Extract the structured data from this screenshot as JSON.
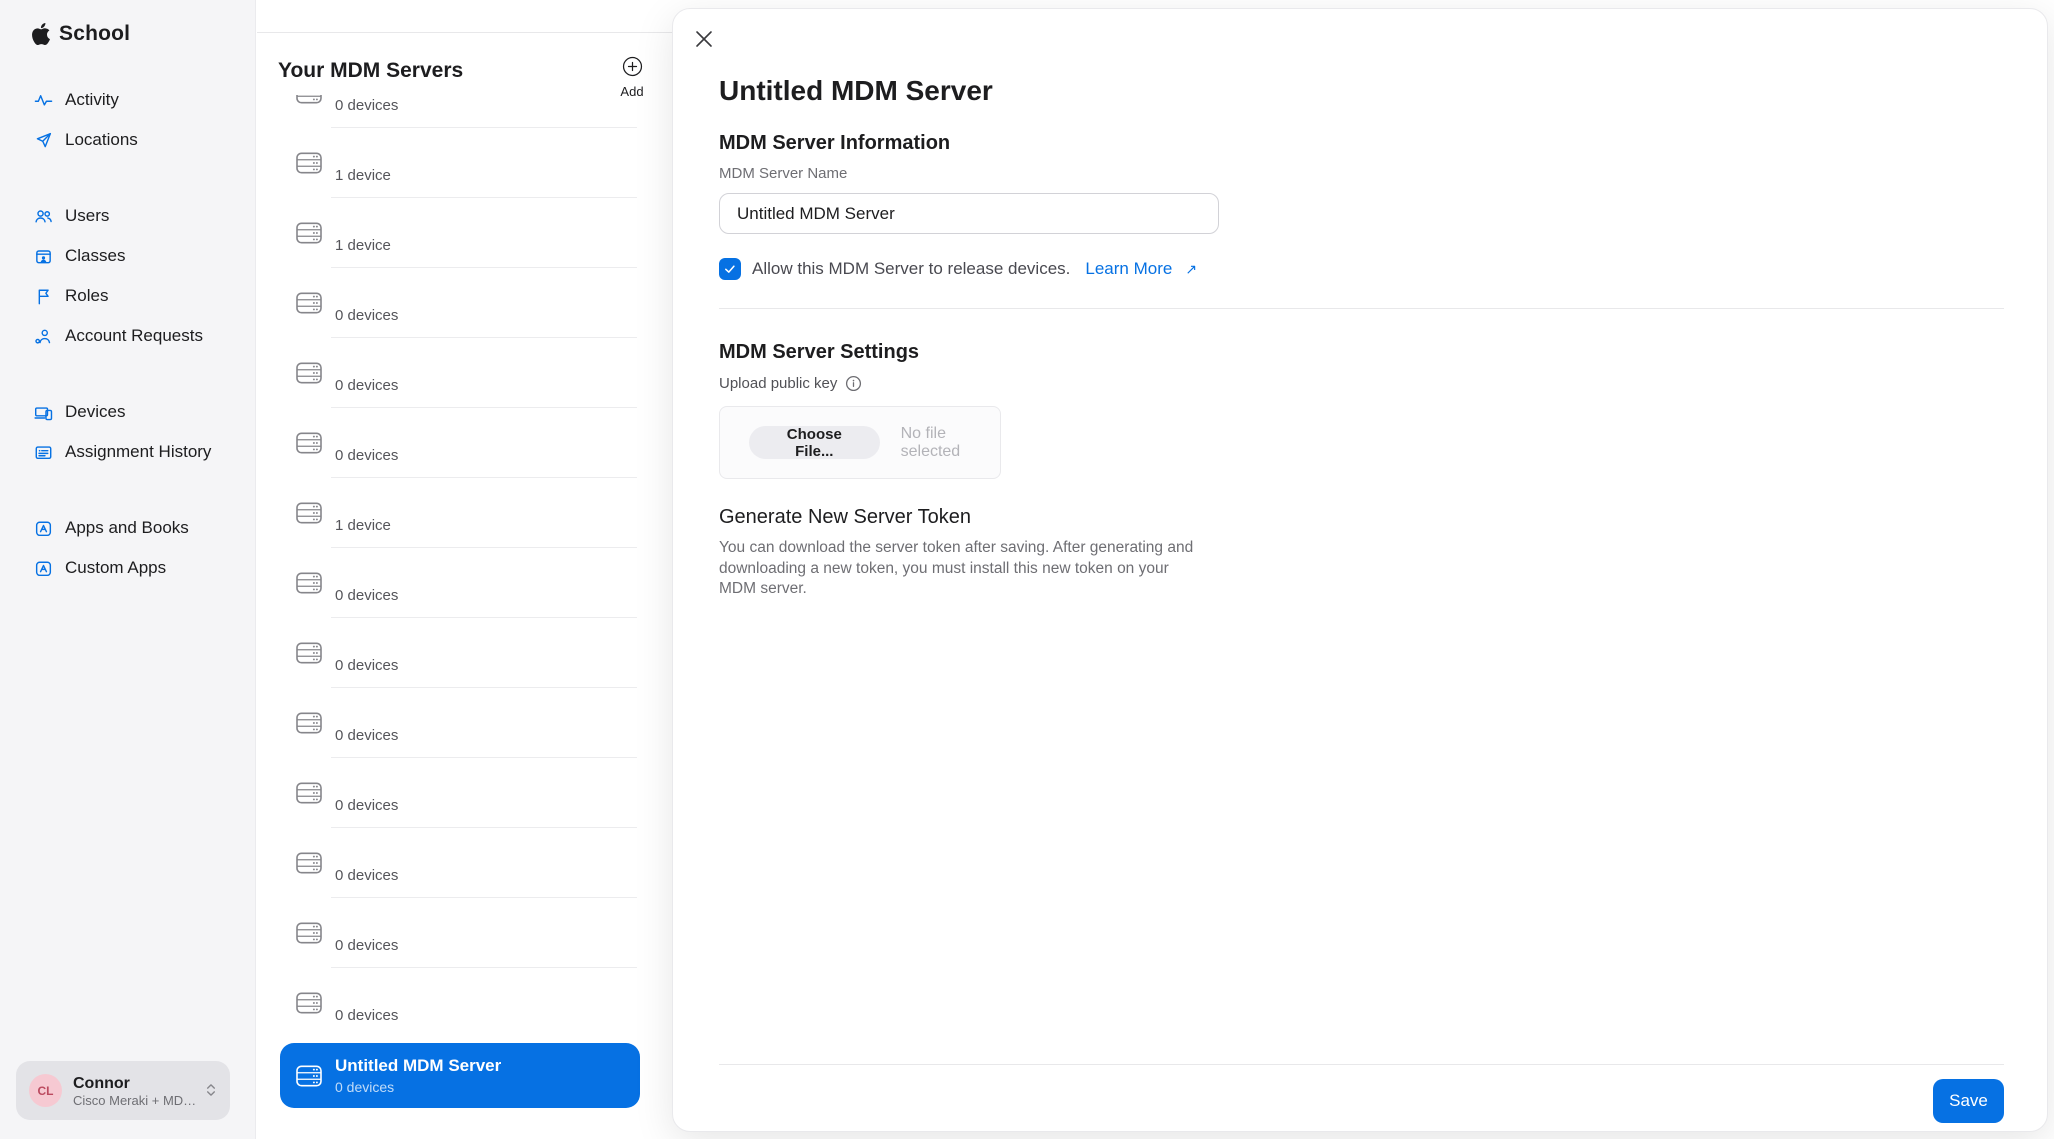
{
  "app": {
    "name": "School"
  },
  "sidebar": {
    "groups": [
      {
        "items": [
          {
            "icon": "activity-icon",
            "label": "Activity"
          },
          {
            "icon": "locations-icon",
            "label": "Locations"
          }
        ]
      },
      {
        "items": [
          {
            "icon": "users-icon",
            "label": "Users"
          },
          {
            "icon": "classes-icon",
            "label": "Classes"
          },
          {
            "icon": "roles-icon",
            "label": "Roles"
          },
          {
            "icon": "account-requests-icon",
            "label": "Account Requests"
          }
        ]
      },
      {
        "items": [
          {
            "icon": "devices-icon",
            "label": "Devices"
          },
          {
            "icon": "assignment-history-icon",
            "label": "Assignment History"
          }
        ]
      },
      {
        "items": [
          {
            "icon": "apps-icon",
            "label": "Apps and Books"
          },
          {
            "icon": "apps-icon",
            "label": "Custom Apps"
          }
        ]
      }
    ],
    "user": {
      "initials": "CL",
      "name": "Connor",
      "subtitle": "Cisco Meraki + MDM De…"
    }
  },
  "server_list": {
    "title": "Your MDM Servers",
    "add_label": "Add",
    "items": [
      {
        "name": "",
        "devices": "0 devices",
        "state": "partial"
      },
      {
        "name": "",
        "devices": "1 device",
        "state": "normal"
      },
      {
        "name": "",
        "devices": "1 device",
        "state": "normal"
      },
      {
        "name": "",
        "devices": "0 devices",
        "state": "normal"
      },
      {
        "name": "",
        "devices": "0 devices",
        "state": "normal"
      },
      {
        "name": "",
        "devices": "0 devices",
        "state": "normal"
      },
      {
        "name": "",
        "devices": "1 device",
        "state": "normal"
      },
      {
        "name": "",
        "devices": "0 devices",
        "state": "normal"
      },
      {
        "name": "",
        "devices": "0 devices",
        "state": "normal"
      },
      {
        "name": "",
        "devices": "0 devices",
        "state": "normal"
      },
      {
        "name": "",
        "devices": "0 devices",
        "state": "normal"
      },
      {
        "name": "",
        "devices": "0 devices",
        "state": "normal"
      },
      {
        "name": "",
        "devices": "0 devices",
        "state": "normal"
      },
      {
        "name": "",
        "devices": "0 devices",
        "state": "normal"
      },
      {
        "name": "Untitled MDM Server",
        "devices": "0 devices",
        "state": "selected"
      }
    ]
  },
  "panel": {
    "title": "Untitled MDM Server",
    "info_section": {
      "heading": "MDM Server Information",
      "name_label": "MDM Server Name",
      "name_value": "Untitled MDM Server",
      "release_label": "Allow this MDM Server to release devices.",
      "learn_more_label": "Learn More",
      "learn_more_arrow": "↗",
      "checkbox_checked": true
    },
    "settings_section": {
      "heading": "MDM Server Settings",
      "upload_label": "Upload public key",
      "choose_file_label": "Choose File...",
      "no_file_label": "No file selected"
    },
    "token_section": {
      "heading": "Generate New Server Token",
      "description": "You can download the server token after saving. After generating and downloading a new token, you must install this new token on your MDM server."
    },
    "save_label": "Save"
  },
  "colors": {
    "accent": "#0671e3",
    "sidebar_bg": "#f5f5f7",
    "selected_row_bg": "#0671e3",
    "link": "#0671e3",
    "avatar_bg": "#f6c9d2",
    "avatar_text": "#bb4a5f"
  }
}
